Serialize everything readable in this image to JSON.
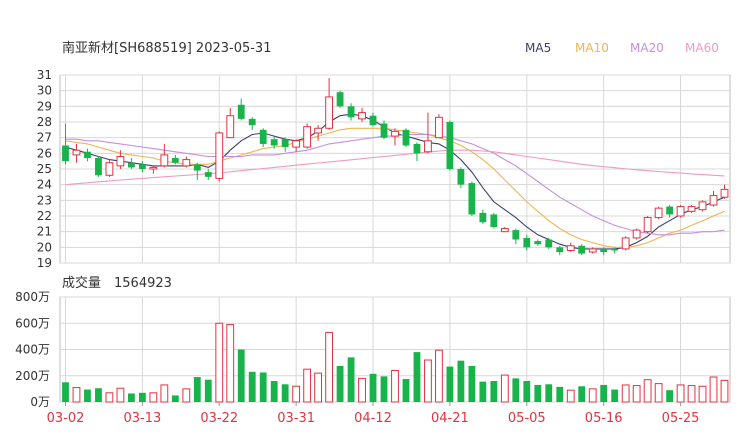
{
  "header": {
    "title": "南亚新材[SH688519] 2023-05-31",
    "volume_title": "成交量",
    "volume_value": "1564923"
  },
  "legend": [
    {
      "label": "MA5",
      "color": "#3a3f6b"
    },
    {
      "label": "MA10",
      "color": "#f2b350"
    },
    {
      "label": "MA20",
      "color": "#c88ee0"
    },
    {
      "label": "MA60",
      "color": "#f09ac2"
    }
  ],
  "colors": {
    "up": "#e0343f",
    "down": "#18b34a",
    "grid": "#d8d8d8"
  },
  "chart_data": [
    {
      "type": "candlestick",
      "title": "南亚新材[SH688519] 2023-05-31",
      "ylim": [
        19,
        31
      ],
      "yticks": [
        "31",
        "30",
        "29",
        "28",
        "27",
        "26",
        "25",
        "24",
        "23",
        "22",
        "21",
        "20",
        "19"
      ],
      "xtick_labels": [
        "03-02",
        "03-13",
        "03-22",
        "03-31",
        "04-12",
        "04-21",
        "05-05",
        "05-16",
        "05-25"
      ],
      "xtick_indices": [
        0,
        7,
        14,
        21,
        28,
        35,
        42,
        49,
        56
      ],
      "series_candles": [
        [
          26.5,
          25.5,
          27.9,
          25.3
        ],
        [
          25.9,
          26.2,
          26.6,
          25.4
        ],
        [
          26.1,
          25.7,
          26.3,
          25.5
        ],
        [
          25.7,
          24.6,
          25.8,
          24.5
        ],
        [
          24.6,
          25.4,
          25.6,
          24.5
        ],
        [
          25.2,
          25.8,
          26.2,
          25.0
        ],
        [
          25.4,
          25.1,
          25.7,
          25.0
        ],
        [
          25.3,
          25.0,
          25.5,
          24.8
        ],
        [
          25.0,
          25.1,
          25.2,
          24.7
        ],
        [
          25.2,
          25.9,
          26.6,
          25.1
        ],
        [
          25.7,
          25.4,
          25.9,
          25.3
        ],
        [
          25.2,
          25.6,
          25.8,
          25.1
        ],
        [
          25.3,
          24.9,
          25.4,
          24.3
        ],
        [
          24.8,
          24.5,
          25.0,
          24.3
        ],
        [
          24.4,
          27.3,
          27.4,
          24.2
        ],
        [
          27.0,
          28.4,
          28.9,
          27.0
        ],
        [
          29.1,
          28.2,
          29.5,
          28.1
        ],
        [
          28.2,
          27.8,
          28.3,
          27.5
        ],
        [
          27.5,
          26.6,
          27.6,
          26.4
        ],
        [
          26.9,
          26.5,
          27.1,
          26.3
        ],
        [
          26.9,
          26.4,
          27.0,
          26.1
        ],
        [
          26.4,
          26.8,
          26.9,
          26.1
        ],
        [
          26.4,
          27.7,
          27.9,
          26.3
        ],
        [
          27.3,
          27.6,
          27.8,
          26.8
        ],
        [
          27.6,
          29.6,
          30.8,
          27.5
        ],
        [
          29.9,
          29.0,
          30.0,
          28.9
        ],
        [
          29.0,
          28.3,
          29.2,
          28.1
        ],
        [
          28.2,
          28.6,
          28.9,
          28.0
        ],
        [
          28.4,
          27.8,
          28.6,
          27.7
        ],
        [
          27.9,
          27.0,
          28.1,
          26.9
        ],
        [
          27.1,
          27.4,
          27.6,
          26.5
        ],
        [
          27.5,
          26.5,
          27.6,
          26.4
        ],
        [
          26.6,
          26.0,
          26.7,
          25.5
        ],
        [
          26.1,
          26.8,
          28.6,
          26.0
        ],
        [
          27.0,
          28.3,
          28.5,
          27.0
        ],
        [
          28.0,
          25.0,
          28.1,
          24.9
        ],
        [
          25.0,
          24.0,
          25.1,
          23.8
        ],
        [
          24.1,
          22.1,
          24.2,
          22.0
        ],
        [
          22.2,
          21.6,
          22.4,
          21.5
        ],
        [
          22.1,
          21.3,
          22.2,
          21.2
        ],
        [
          21.0,
          21.2,
          21.3,
          21.0
        ],
        [
          21.1,
          20.5,
          21.2,
          20.2
        ],
        [
          20.6,
          20.0,
          20.8,
          19.8
        ],
        [
          20.4,
          20.2,
          20.5,
          20.1
        ],
        [
          20.5,
          20.0,
          20.6,
          19.9
        ],
        [
          20.0,
          19.7,
          20.1,
          19.5
        ],
        [
          19.8,
          20.1,
          20.3,
          19.7
        ],
        [
          20.1,
          19.6,
          20.2,
          19.5
        ],
        [
          19.7,
          19.9,
          20.0,
          19.6
        ],
        [
          19.9,
          19.7,
          20.0,
          19.5
        ],
        [
          19.9,
          19.8,
          20.0,
          19.6
        ],
        [
          19.9,
          20.6,
          20.7,
          19.8
        ],
        [
          20.6,
          21.1,
          21.2,
          20.5
        ],
        [
          21.0,
          21.9,
          22.0,
          20.9
        ],
        [
          21.9,
          22.5,
          22.6,
          21.8
        ],
        [
          22.6,
          22.1,
          22.7,
          21.9
        ],
        [
          22.0,
          22.6,
          22.7,
          21.9
        ],
        [
          22.3,
          22.6,
          22.7,
          22.2
        ],
        [
          22.4,
          22.9,
          23.0,
          22.3
        ],
        [
          22.7,
          23.3,
          23.6,
          22.6
        ],
        [
          23.2,
          23.7,
          24.0,
          23.1
        ]
      ],
      "ma_series": [
        {
          "name": "MA5",
          "values": [
            26.4,
            26.2,
            26.0,
            25.8,
            25.6,
            25.5,
            25.4,
            25.3,
            25.2,
            25.2,
            25.2,
            25.2,
            25.3,
            25.1,
            25.5,
            26.2,
            26.8,
            27.2,
            27.3,
            27.1,
            26.9,
            26.8,
            27.0,
            27.4,
            28.0,
            28.4,
            28.5,
            28.4,
            28.1,
            27.7,
            27.3,
            27.1,
            26.9,
            26.7,
            26.6,
            26.2,
            25.6,
            24.8,
            23.8,
            22.9,
            22.4,
            21.9,
            21.3,
            20.8,
            20.5,
            20.2,
            20.0,
            19.9,
            19.9,
            19.9,
            19.9,
            20.0,
            20.3,
            20.7,
            21.3,
            21.7,
            22.1,
            22.4,
            22.6,
            22.9,
            23.2
          ]
        },
        {
          "name": "MA10",
          "values": [
            26.8,
            26.7,
            26.6,
            26.4,
            26.2,
            26.0,
            25.9,
            25.8,
            25.7,
            25.5,
            25.4,
            25.3,
            25.3,
            25.3,
            25.5,
            25.7,
            25.9,
            26.1,
            26.3,
            26.4,
            26.5,
            26.7,
            26.9,
            27.1,
            27.3,
            27.5,
            27.6,
            27.6,
            27.6,
            27.6,
            27.5,
            27.4,
            27.3,
            27.2,
            27.0,
            26.8,
            26.5,
            26.1,
            25.6,
            25.0,
            24.3,
            23.6,
            22.9,
            22.3,
            21.7,
            21.2,
            20.8,
            20.5,
            20.3,
            20.1,
            20.0,
            20.0,
            20.1,
            20.3,
            20.6,
            20.9,
            21.1,
            21.4,
            21.7,
            22.0,
            22.3
          ]
        },
        {
          "name": "MA20",
          "values": [
            26.9,
            26.9,
            26.8,
            26.8,
            26.7,
            26.6,
            26.5,
            26.4,
            26.3,
            26.2,
            26.1,
            26.0,
            25.9,
            25.8,
            25.8,
            25.8,
            25.8,
            25.9,
            25.9,
            25.9,
            26.0,
            26.1,
            26.2,
            26.4,
            26.6,
            26.7,
            26.8,
            26.9,
            27.0,
            27.1,
            27.1,
            27.2,
            27.2,
            27.2,
            27.1,
            27.0,
            26.8,
            26.6,
            26.3,
            26.0,
            25.6,
            25.2,
            24.7,
            24.2,
            23.7,
            23.2,
            22.8,
            22.4,
            22.0,
            21.7,
            21.4,
            21.2,
            21.0,
            20.9,
            20.8,
            20.8,
            20.9,
            20.9,
            21.0,
            21.0,
            21.1
          ]
        },
        {
          "name": "MA60",
          "values": [
            24.0,
            24.06,
            24.12,
            24.18,
            24.24,
            24.3,
            24.35,
            24.4,
            24.45,
            24.5,
            24.55,
            24.6,
            24.65,
            24.7,
            24.75,
            24.82,
            24.89,
            24.96,
            25.03,
            25.1,
            25.17,
            25.24,
            25.31,
            25.38,
            25.45,
            25.52,
            25.59,
            25.66,
            25.73,
            25.8,
            25.87,
            25.94,
            26.01,
            26.08,
            26.15,
            26.2,
            26.2,
            26.2,
            26.15,
            26.1,
            26.0,
            25.9,
            25.8,
            25.7,
            25.6,
            25.5,
            25.4,
            25.3,
            25.22,
            25.15,
            25.08,
            25.01,
            24.95,
            24.89,
            24.84,
            24.79,
            24.74,
            24.69,
            24.64,
            24.6,
            24.56
          ]
        }
      ]
    },
    {
      "type": "bar",
      "title": "成交量",
      "yticks": [
        "800万",
        "600万",
        "400万",
        "200万",
        "0万"
      ],
      "ylim": [
        0,
        800
      ],
      "unit": "万",
      "values": [
        150,
        110,
        95,
        105,
        70,
        105,
        65,
        70,
        70,
        130,
        50,
        100,
        190,
        170,
        600,
        590,
        400,
        230,
        225,
        160,
        135,
        120,
        250,
        220,
        530,
        275,
        340,
        180,
        215,
        195,
        240,
        175,
        380,
        320,
        395,
        270,
        315,
        275,
        155,
        160,
        205,
        180,
        160,
        130,
        135,
        115,
        90,
        120,
        100,
        130,
        95,
        130,
        125,
        170,
        140,
        90,
        130,
        125,
        120,
        190,
        165
      ]
    }
  ]
}
